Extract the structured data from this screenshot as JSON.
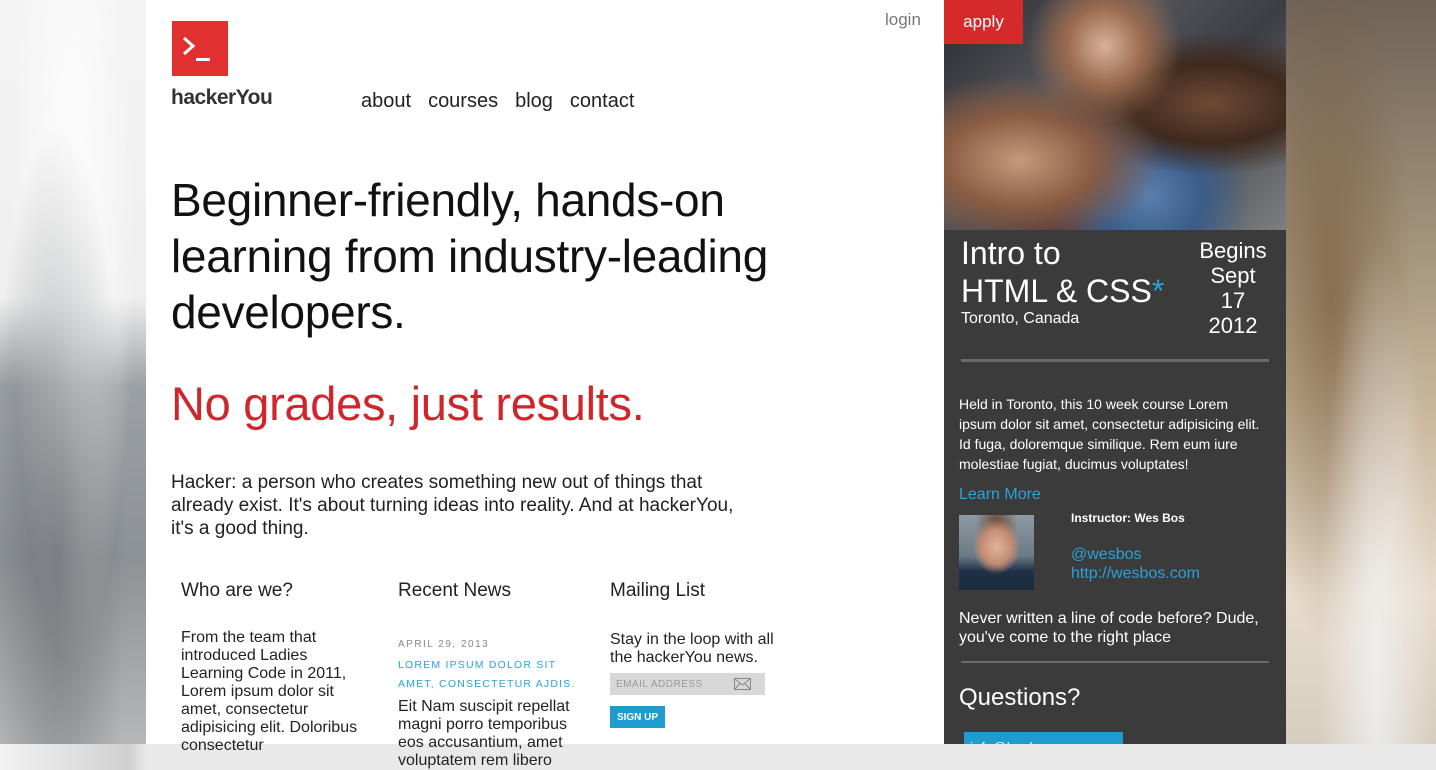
{
  "header": {
    "brand": "hackerYou",
    "nav": [
      "about",
      "courses",
      "blog",
      "contact"
    ],
    "login": "login",
    "apply": "apply"
  },
  "hero": {
    "headline": "Beginner-friendly, hands-on learning from industry-leading developers.",
    "tagline": "No grades, just results.",
    "intro": "Hacker: a person who creates something new out of things that already exist. It's about turning ideas into reality. And at hackerYou, it's a good thing."
  },
  "who": {
    "title": "Who are we?",
    "text": "From the team that introduced Ladies Learning Code in 2011, Lorem ipsum dolor sit amet, consectetur adipisicing elit. Doloribus consectetur"
  },
  "news": {
    "title": "Recent News",
    "date": "APRIL 29, 2013",
    "headline": "LOREM IPSUM DOLOR SIT AMET, CONSECTETUR AJDIS.",
    "body": "Eit Nam suscipit repellat magni porro temporibus eos accusantium, amet voluptatem rem libero"
  },
  "mailing": {
    "title": "Mailing List",
    "text": "Stay in the loop with all the hackerYou news.",
    "placeholder": "EMAIL ADDRESS",
    "signup": "SIGN UP"
  },
  "course": {
    "title_line1": "Intro to",
    "title_line2": "HTML & CSS",
    "star": "*",
    "location": "Toronto, Canada",
    "begins": "Begins",
    "month": "Sept",
    "day": "17",
    "year": "2012",
    "description": "Held in Toronto, this 10 week course Lorem ipsum dolor sit amet, consectetur adipisicing elit. Id fuga, doloremque similique. Rem eum iure molestiae fugiat, ducimus voluptates!",
    "learn_more": "Learn More",
    "instructor": "Instructor: Wes Bos",
    "twitter": "@wesbos",
    "website": "http://wesbos.com",
    "never": "Never written a line of code before? Dude, you've come to the right place",
    "questions": "Questions?",
    "email": "info@hackeryou.com"
  },
  "colors": {
    "brand_red": "#e0302f",
    "accent_blue": "#29a3d8",
    "sidebar": "#3b3b3b"
  }
}
